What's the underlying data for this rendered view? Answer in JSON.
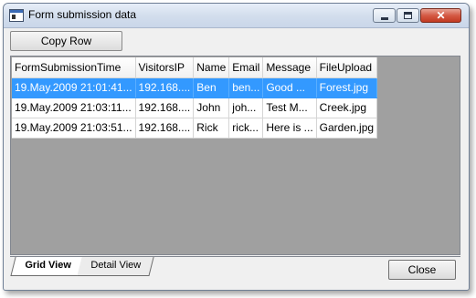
{
  "window": {
    "title": "Form submission data"
  },
  "toolbar": {
    "copy_row_label": "Copy Row"
  },
  "grid": {
    "columns": [
      "FormSubmissionTime",
      "VisitorsIP",
      "Name",
      "Email",
      "Message",
      "FileUpload"
    ],
    "rows": [
      [
        "19.May.2009 21:01:41...",
        "192.168....",
        "Ben",
        "ben...",
        "Good ...",
        "Forest.jpg"
      ],
      [
        "19.May.2009 21:03:11...",
        "192.168....",
        "John",
        "joh...",
        "Test M...",
        "Creek.jpg"
      ],
      [
        "19.May.2009 21:03:51...",
        "192.168....",
        "Rick",
        "rick...",
        "Here is ...",
        "Garden.jpg"
      ]
    ],
    "selected_row": 0,
    "selection_color": "#3399ff"
  },
  "tabs": [
    {
      "label": "Grid View",
      "active": true
    },
    {
      "label": "Detail View",
      "active": false
    }
  ],
  "footer": {
    "close_label": "Close"
  }
}
